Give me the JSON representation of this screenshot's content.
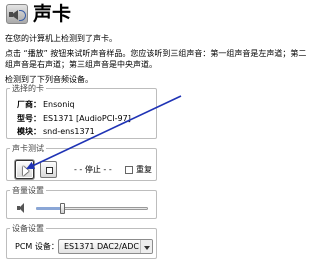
{
  "header": {
    "title": "声卡",
    "subtitle": "在您的计算机上检测到了声卡。"
  },
  "instructions": {
    "line1": "点击 “播放” 按钮来试听声音样品。您应该听到三组声音：第一组声音是左声道；第二",
    "line2": "组声音是右声道；第三组声音是中央声道。"
  },
  "detected": "检测到了下列音频设备。",
  "selected_card": {
    "legend": "选择的卡",
    "rows": [
      {
        "label": "厂商：",
        "value": "Ensoniq"
      },
      {
        "label": "型号：",
        "value": "ES1371 [AudioPCI-97]"
      },
      {
        "label": "模块：",
        "value": "snd-ens1371"
      }
    ]
  },
  "sound_test": {
    "legend": "声卡测试",
    "status": "- - 停止 - -",
    "repeat_label": "重复",
    "repeat_checked": false
  },
  "volume": {
    "legend": "音量设置",
    "level": 0.22
  },
  "device": {
    "legend": "设备设置",
    "pcm_label": "PCM 设备：",
    "pcm_value": "ES1371 DAC2/ADC"
  },
  "annotation": {
    "arrow_color": "#1f33b5"
  }
}
